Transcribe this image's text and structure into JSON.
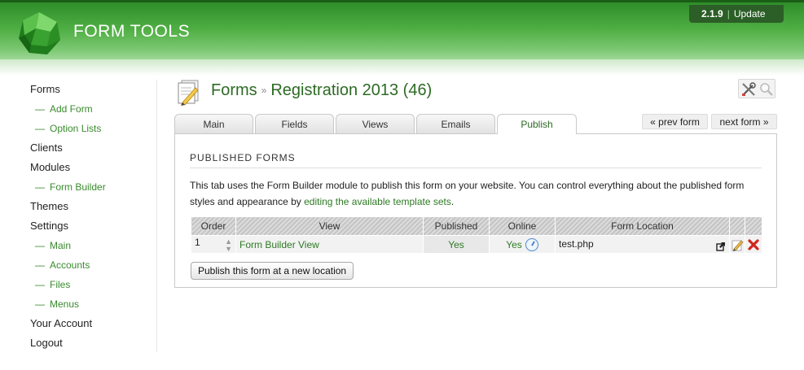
{
  "header": {
    "app_title": "FORM TOOLS",
    "version": "2.1.9",
    "update_label": "Update",
    "version_separator": "|"
  },
  "sidebar": {
    "items": [
      {
        "label": "Forms",
        "sub": false
      },
      {
        "label": "Add Form",
        "sub": true
      },
      {
        "label": "Option Lists",
        "sub": true
      },
      {
        "label": "Clients",
        "sub": false
      },
      {
        "label": "Modules",
        "sub": false
      },
      {
        "label": "Form Builder",
        "sub": true
      },
      {
        "label": "Themes",
        "sub": false
      },
      {
        "label": "Settings",
        "sub": false
      },
      {
        "label": "Main",
        "sub": true
      },
      {
        "label": "Accounts",
        "sub": true
      },
      {
        "label": "Files",
        "sub": true
      },
      {
        "label": "Menus",
        "sub": true
      },
      {
        "label": "Your Account",
        "sub": false
      },
      {
        "label": "Logout",
        "sub": false
      }
    ],
    "sub_prefix": "—"
  },
  "breadcrumb": {
    "root": "Forms",
    "separator": "»",
    "current": "Registration 2013 (46)"
  },
  "tabs": [
    {
      "label": "Main",
      "active": false
    },
    {
      "label": "Fields",
      "active": false
    },
    {
      "label": "Views",
      "active": false
    },
    {
      "label": "Emails",
      "active": false
    },
    {
      "label": "Publish",
      "active": true
    }
  ],
  "pager": {
    "prev_label": "« prev form",
    "next_label": "next form »"
  },
  "panel": {
    "section_title": "PUBLISHED FORMS",
    "description_before": "This tab uses the Form Builder module to publish this form on your website. You can control everything about the published form styles and appearance by ",
    "description_link": "editing the available template sets",
    "description_after": "."
  },
  "table": {
    "headers": [
      "Order",
      "View",
      "Published",
      "Online",
      "Form Location",
      "",
      ""
    ],
    "rows": [
      {
        "order": "1",
        "view": "Form Builder View",
        "published": "Yes",
        "online": "Yes",
        "location": "test.php"
      }
    ]
  },
  "publish_button_label": "Publish this form at a new location",
  "icons": {
    "logo": "form-tools-logo-icon",
    "page": "forms-page-icon",
    "tools": "tools-icon",
    "search": "search-icon",
    "sort": "sort-arrows-icon",
    "clock": "clock-icon",
    "external": "external-link-icon",
    "edit": "edit-pencil-icon",
    "delete": "delete-x-icon"
  },
  "colors": {
    "brand_green": "#4fae43",
    "link_green": "#2d7a23",
    "delete_red": "#d0261c"
  }
}
